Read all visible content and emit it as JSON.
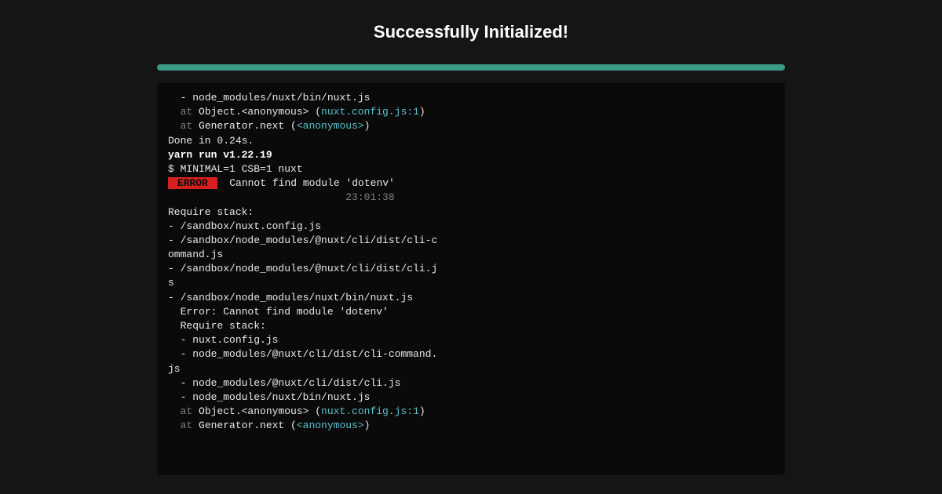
{
  "title": "Successfully Initialized!",
  "terminal": {
    "l1_prefix": "  - ",
    "l1_path": "node_modules/nuxt/bin/nuxt.js",
    "l2_at": "  at ",
    "l2_obj": "Object.<anonymous> (",
    "l2_link": "nuxt.config.js:1",
    "l2_close": ")",
    "l3_at": "  at ",
    "l3_obj": "Generator.next (",
    "l3_link": "<anonymous>",
    "l3_close": ")",
    "blank": "",
    "done": "Done in 0.24s.",
    "yarn": "yarn run v1.22.19",
    "cmd": "$ MINIMAL=1 CSB=1 nuxt",
    "err_label": " ERROR ",
    "err_msg": "  Cannot find module 'dotenv'",
    "err_time_pad": "                             ",
    "err_time": "23:01:38",
    "req_stack": "Require stack:",
    "rs1": "- /sandbox/nuxt.config.js",
    "rs2": "- /sandbox/node_modules/@nuxt/cli/dist/cli-c",
    "rs2b": "ommand.js",
    "rs3": "- /sandbox/node_modules/@nuxt/cli/dist/cli.j",
    "rs3b": "s",
    "rs4": "- /sandbox/node_modules/nuxt/bin/nuxt.js",
    "err2": "  Error: Cannot find module 'dotenv'",
    "req2": "  Require stack:",
    "r2_1": "  - nuxt.config.js",
    "r2_2": "  - node_modules/@nuxt/cli/dist/cli-command.",
    "r2_2b": "js",
    "r2_3": "  - node_modules/@nuxt/cli/dist/cli.js",
    "r2_4": "  - node_modules/nuxt/bin/nuxt.js",
    "t2_at1": "  at ",
    "t2_obj1": "Object.<anonymous> (",
    "t2_link1": "nuxt.config.js:1",
    "t2_close1": ")",
    "t2_at2": "  at ",
    "t2_obj2": "Generator.next (",
    "t2_link2": "<anonymous>",
    "t2_close2": ")"
  }
}
